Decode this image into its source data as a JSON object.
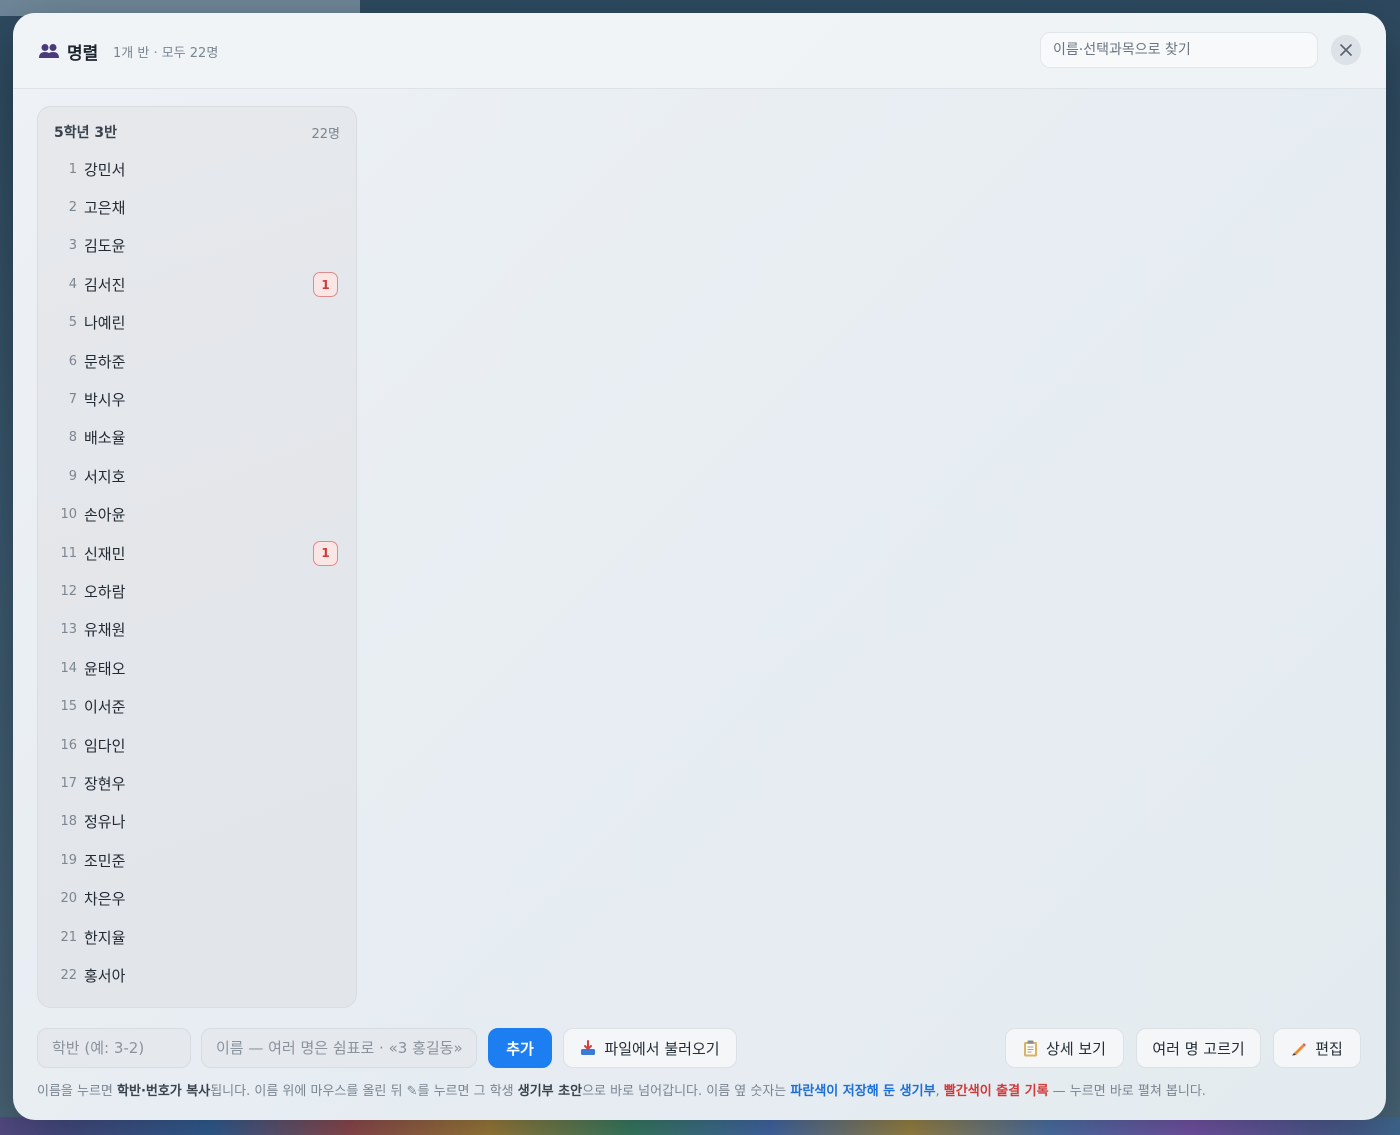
{
  "header": {
    "title": "명렬",
    "subtitle": "1개 반 · 모두 22명",
    "search_placeholder": "이름·선택과목으로 찾기"
  },
  "roster": {
    "class_name": "5학년 3반",
    "class_count": "22명",
    "students": [
      {
        "num": "1",
        "name": "강민서",
        "badge": ""
      },
      {
        "num": "2",
        "name": "고은채",
        "badge": ""
      },
      {
        "num": "3",
        "name": "김도윤",
        "badge": ""
      },
      {
        "num": "4",
        "name": "김서진",
        "badge": "1"
      },
      {
        "num": "5",
        "name": "나예린",
        "badge": ""
      },
      {
        "num": "6",
        "name": "문하준",
        "badge": ""
      },
      {
        "num": "7",
        "name": "박시우",
        "badge": ""
      },
      {
        "num": "8",
        "name": "배소율",
        "badge": ""
      },
      {
        "num": "9",
        "name": "서지호",
        "badge": ""
      },
      {
        "num": "10",
        "name": "손아윤",
        "badge": ""
      },
      {
        "num": "11",
        "name": "신재민",
        "badge": "1"
      },
      {
        "num": "12",
        "name": "오하람",
        "badge": ""
      },
      {
        "num": "13",
        "name": "유채원",
        "badge": ""
      },
      {
        "num": "14",
        "name": "윤태오",
        "badge": ""
      },
      {
        "num": "15",
        "name": "이서준",
        "badge": ""
      },
      {
        "num": "16",
        "name": "임다인",
        "badge": ""
      },
      {
        "num": "17",
        "name": "장현우",
        "badge": ""
      },
      {
        "num": "18",
        "name": "정유나",
        "badge": ""
      },
      {
        "num": "19",
        "name": "조민준",
        "badge": ""
      },
      {
        "num": "20",
        "name": "차은우",
        "badge": ""
      },
      {
        "num": "21",
        "name": "한지율",
        "badge": ""
      },
      {
        "num": "22",
        "name": "홍서아",
        "badge": ""
      }
    ]
  },
  "footer": {
    "class_placeholder": "학반 (예: 3-2)",
    "name_placeholder": "이름 — 여러 명은 쉼표로 · «3 홍길동»",
    "add_label": "추가",
    "import_label": "파일에서 불러오기",
    "detail_label": "상세 보기",
    "multi_label": "여러 명 고르기",
    "edit_label": "편집"
  },
  "hint": {
    "p1": "이름을 누르면 ",
    "b1": "학반·번호가 복사",
    "p2": "됩니다. 이름 위에 마우스를 올린 뒤 ",
    "pencil": "✎",
    "p3": "를 누르면 그 학생 ",
    "b2": "생기부 초안",
    "p4": "으로 바로 넘어갑니다. 이름 옆 숫자는 ",
    "blue": "파란색이 저장해 둔 생기부",
    "p5": ", ",
    "red": "빨간색이 출결 기록",
    "p6": " — 누르면 바로 펼쳐 봅니다."
  },
  "colors": {
    "accent": "#1c7ef0",
    "badge_red": "#d03a3a",
    "hint_blue": "#1c6fd8"
  }
}
